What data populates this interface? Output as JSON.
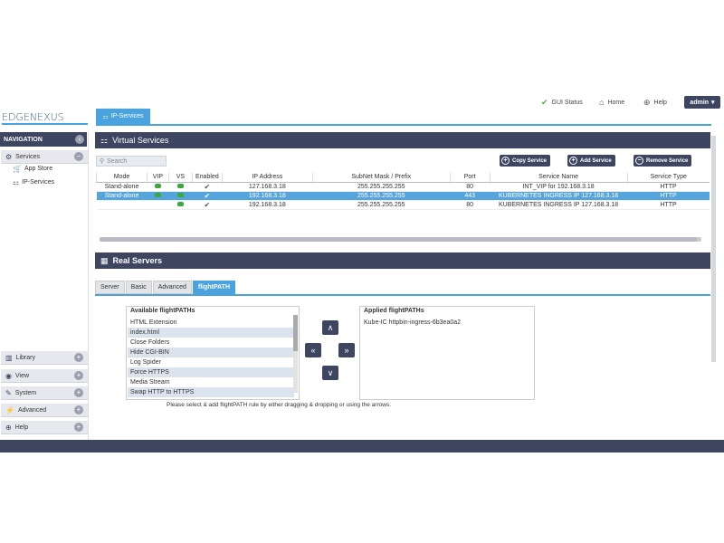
{
  "topbar": {
    "gui_status": "GUI Status",
    "home": "Home",
    "help": "Help",
    "admin": "admin"
  },
  "logo": {
    "text": "EDGENEXUS"
  },
  "main_tab": {
    "label": "IP-Services"
  },
  "sidebar": {
    "header": "NAVIGATION",
    "services": "Services",
    "items": [
      {
        "label": "App Store"
      },
      {
        "label": "IP-Services"
      }
    ],
    "sections": [
      {
        "label": "Library"
      },
      {
        "label": "View"
      },
      {
        "label": "System"
      },
      {
        "label": "Advanced"
      },
      {
        "label": "Help"
      }
    ]
  },
  "virtual_services": {
    "title": "Virtual Services",
    "search_placeholder": "Search",
    "buttons": {
      "copy": "Copy Service",
      "add": "Add Service",
      "remove": "Remove Service"
    },
    "columns": [
      "Mode",
      "VIP",
      "VS",
      "Enabled",
      "IP Address",
      "SubNet Mask / Prefix",
      "Port",
      "Service Name",
      "Service Type"
    ],
    "rows": [
      {
        "mode": "Stand-alone",
        "ip": "127.168.3.18",
        "mask": "255.255.255.255",
        "port": "80",
        "name": "INT_VIP for 192.168.3.18",
        "type": "HTTP"
      },
      {
        "mode": "Stand-alone",
        "ip": "192.168.3.18",
        "mask": "255.255.255.255",
        "port": "443",
        "name": "KUBERNETES INGRESS IP 127.168.3.18",
        "type": "HTTP"
      },
      {
        "mode": "",
        "ip": "192.168.3.18",
        "mask": "255.255.255.255",
        "port": "80",
        "name": "KUBERNETES INGRESS IP 127.168.3.18",
        "type": "HTTP"
      }
    ]
  },
  "real_servers": {
    "title": "Real Servers",
    "tabs": [
      "Server",
      "Basic",
      "Advanced",
      "flightPATH"
    ]
  },
  "flightpath": {
    "available_title": "Available flightPATHs",
    "available": [
      "HTML Extension",
      "index.html",
      "Close Folders",
      "Hide CGI-BIN",
      "Log Spider",
      "Force HTTPS",
      "Media Stream",
      "Swap HTTP to HTTPS"
    ],
    "applied_title": "Applied flightPATHs",
    "applied": [
      "Kube-IC httpbin-ingress-6b3ea0a2"
    ],
    "hint": "Please select & add flightPATH rule by either dragging & dropping or using the arrows."
  },
  "colors": {
    "dark": "#3d4560",
    "accent": "#4aa3df",
    "selected_row": "#56a4dc",
    "status_green": "#3aa83a"
  }
}
